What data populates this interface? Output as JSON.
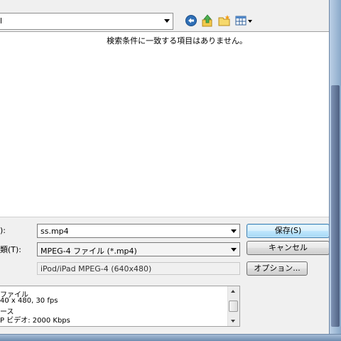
{
  "location": {
    "text": "l"
  },
  "toolbar": {
    "back_icon": "back-arrow-icon",
    "up_icon": "up-folder-icon",
    "new_folder_icon": "new-folder-icon",
    "views_icon": "views-menu-icon"
  },
  "file_list": {
    "empty_message": "検索条件に一致する項目はありません。"
  },
  "filename": {
    "label": "):",
    "value": "ss.mp4"
  },
  "filetype": {
    "label": "類(T):",
    "value": "MPEG-4 ファイル (*.mp4)"
  },
  "profile": {
    "value": "iPod/iPad MPEG-4 (640x480)"
  },
  "buttons": {
    "save": "保存(S)",
    "cancel": "キャンセル",
    "options": "オプション..."
  },
  "details": {
    "lines": [
      "ファイル",
      "40 x 480, 30 fps",
      "ース",
      "P ビデオ: 2000 Kbps"
    ]
  },
  "colors": {
    "accent": "#3c7fb1",
    "frame": "#8aa9c9"
  }
}
